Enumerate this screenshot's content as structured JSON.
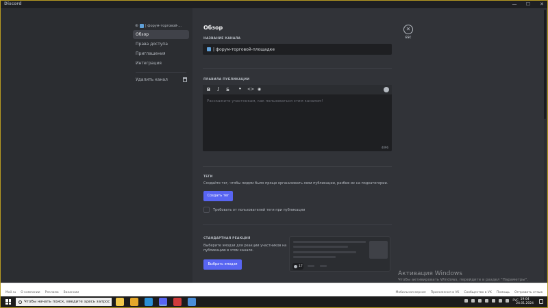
{
  "window": {
    "title": "Discord",
    "controls": [
      "—",
      "☐",
      "✕"
    ]
  },
  "sidebar": {
    "channel_header": "| форум-торговой-...",
    "items": [
      {
        "label": "Обзор",
        "active": true
      },
      {
        "label": "Права доступа",
        "active": false
      },
      {
        "label": "Приглашения",
        "active": false
      },
      {
        "label": "Интеграция",
        "active": false
      }
    ],
    "delete_label": "Удалить канал"
  },
  "main": {
    "title": "Обзор",
    "esc_label": "ESC",
    "channel_name": {
      "label": "НАЗВАНИЕ КАНАЛА",
      "value": "| форум-торговой-площадке"
    },
    "rules": {
      "label": "ПРАВИЛА ПУБЛИКАЦИИ",
      "placeholder": "Расскажите участникам, как пользоваться этим каналом!",
      "counter": "4096",
      "toolbar": [
        "B",
        "I",
        "S",
        "❝",
        "<>",
        "◉"
      ]
    },
    "tags": {
      "label": "ТЕГИ",
      "description": "Создайте тег, чтобы людям было проще организовать свои публикации, разбив их на подкатегории.",
      "button": "Создать тег",
      "checkbox_label": "Требовать от пользователей теги при публикации"
    },
    "reaction": {
      "label": "СТАНДАРТНАЯ РЕАКЦИЯ",
      "description_1": "Выберите эмодзи для реакции участников на",
      "description_2": "публикацию в этом канале.",
      "button": "Выбрать эмодзи",
      "preview_count": "17"
    }
  },
  "activation": {
    "title": "Активация Windows",
    "subtitle": "Чтобы активировать Windows, перейдите в раздел \"Параметры\"."
  },
  "browser_footer": {
    "left_links": [
      "Mail.ru",
      "О компании",
      "Реклама",
      "Вакансии"
    ],
    "right_links": [
      "Мобильная версия",
      "Приложения в VK",
      "Сообщество в VK",
      "Помощь",
      "Отправить отзыв"
    ]
  },
  "taskbar": {
    "search_placeholder": "Чтобы начать поиск, введите здесь запрос",
    "language": "РУС",
    "time": "19:04",
    "date": "24.01.2024",
    "apps": [
      {
        "name": "file-explorer",
        "color": "#f2c84b"
      },
      {
        "name": "chrome",
        "color": "#e4a72a"
      },
      {
        "name": "edge",
        "color": "#2a8fd6"
      },
      {
        "name": "discord",
        "color": "#5865f2"
      },
      {
        "name": "app-red",
        "color": "#d03b3b"
      },
      {
        "name": "app-blue",
        "color": "#4a8dd8"
      }
    ]
  },
  "colors": {
    "accent": "#5865f2",
    "background": "#313338",
    "sidebar": "#2b2d31",
    "input": "#1e1f22"
  }
}
